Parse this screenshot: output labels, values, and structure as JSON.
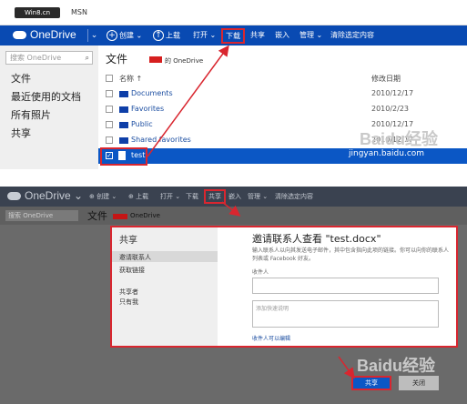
{
  "top": {
    "msn_logo": "Win8.cn",
    "msn_label": "MSN",
    "brand": "OneDrive",
    "toolbar": {
      "create": "创建",
      "upload": "上载",
      "open": "打开",
      "download": "下载",
      "share": "共享",
      "embed": "嵌入",
      "manage": "管理",
      "clear_selection": "清除选定内容"
    },
    "search_placeholder": "搜索 OneDrive",
    "nav": [
      "文件",
      "最近使用的文档",
      "所有照片",
      "共享"
    ],
    "breadcrumb": {
      "title": "文件",
      "owner_suffix": "的 OneDrive"
    },
    "columns": {
      "name": "名称 ↑",
      "modified": "修改日期"
    },
    "rows": [
      {
        "name": "Documents",
        "date": "2010/12/17"
      },
      {
        "name": "Favorites",
        "date": "2010/2/23"
      },
      {
        "name": "Public",
        "date": "2010/12/17"
      },
      {
        "name": "Shared favorites",
        "date": "2010/12/17"
      },
      {
        "name": "test",
        "date": ""
      }
    ],
    "watermark": "Baidu经验",
    "watermark_url": "jingyan.baidu.com"
  },
  "bottom": {
    "brand": "OneDrive",
    "toolbar": {
      "create": "创建",
      "upload": "上载",
      "open": "打开",
      "download": "下载",
      "share": "共享",
      "embed": "嵌入",
      "manage": "管理",
      "clear_selection": "清除选定内容"
    },
    "search_placeholder": "搜索 OneDrive",
    "breadcrumb": {
      "title": "文件",
      "owner_suffix": "OneDrive"
    },
    "dialog": {
      "side_title": "共享",
      "side_items": [
        "邀请联系人",
        "获取链接",
        "共享者",
        "只有我"
      ],
      "heading": "邀请联系人查看 \"test.docx\"",
      "description": "输入联系人以向其发送电子邮件，其中包含指向此项的链接。你可以向你的联系人列表或 Facebook 好友。",
      "to_label": "收件人",
      "note_placeholder": "添加快速说明",
      "permission_link": "收件人可以编辑"
    },
    "share_button": "共享",
    "close_button": "关闭",
    "watermark": "Baidu经验"
  },
  "colors": {
    "accent": "#094ab2",
    "highlight": "#d9262f",
    "selected_row": "#0b57c5"
  }
}
